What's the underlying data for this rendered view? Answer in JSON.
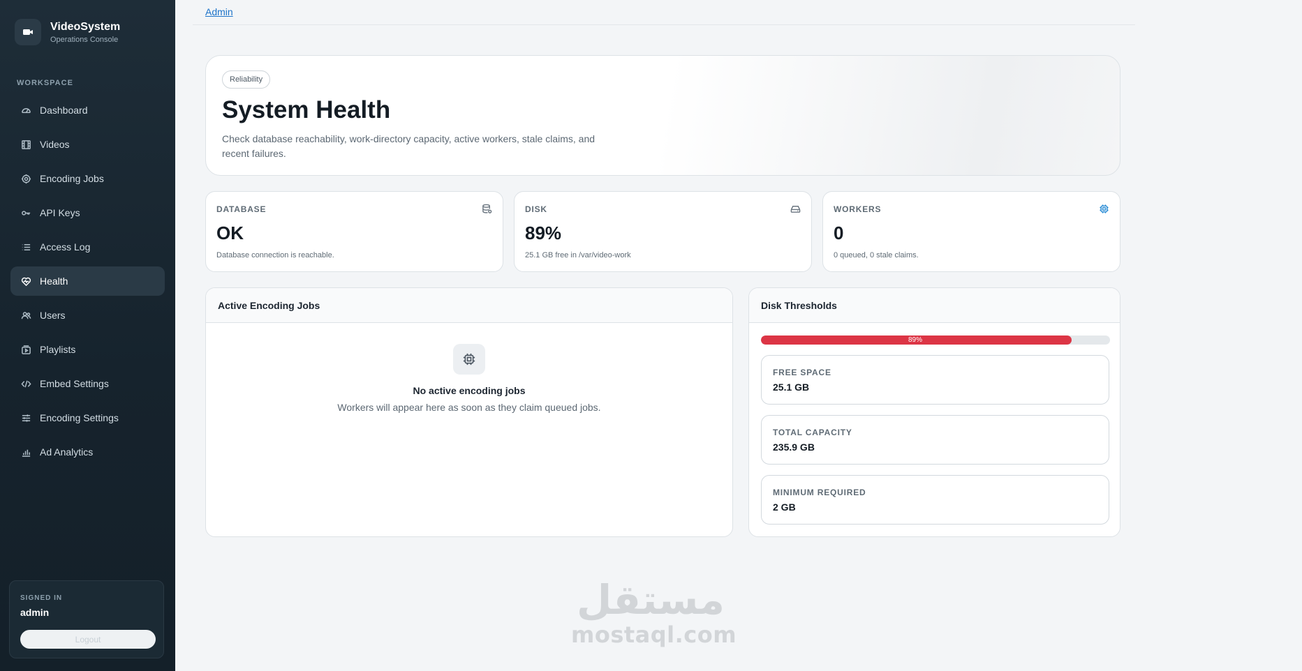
{
  "app": {
    "title": "VideoSystem",
    "subtitle": "Operations Console"
  },
  "sidebar": {
    "section_label": "WORKSPACE",
    "items": [
      {
        "label": "Dashboard",
        "icon": "gauge-icon"
      },
      {
        "label": "Videos",
        "icon": "film-icon"
      },
      {
        "label": "Encoding Jobs",
        "icon": "gear-icon"
      },
      {
        "label": "API Keys",
        "icon": "key-icon"
      },
      {
        "label": "Access Log",
        "icon": "list-icon"
      },
      {
        "label": "Health",
        "icon": "heart-pulse-icon",
        "active": true
      },
      {
        "label": "Users",
        "icon": "users-icon"
      },
      {
        "label": "Playlists",
        "icon": "playlist-icon"
      },
      {
        "label": "Embed Settings",
        "icon": "code-icon"
      },
      {
        "label": "Encoding Settings",
        "icon": "sliders-icon"
      },
      {
        "label": "Ad Analytics",
        "icon": "bar-chart-icon"
      }
    ],
    "user": {
      "label": "SIGNED IN",
      "name": "admin",
      "logout_label": "Logout"
    }
  },
  "breadcrumb": "Admin",
  "hero": {
    "chip": "Reliability",
    "title": "System Health",
    "description": "Check database reachability, work-directory capacity, active workers, stale claims, and recent failures."
  },
  "stats": {
    "database": {
      "label": "DATABASE",
      "value": "OK",
      "sub": "Database connection is reachable.",
      "icon": "database-icon"
    },
    "disk": {
      "label": "DISK",
      "value": "89%",
      "sub": "25.1 GB free in /var/video-work",
      "icon": "hard-drive-icon"
    },
    "workers": {
      "label": "WORKERS",
      "value": "0",
      "sub": "0 queued, 0 stale claims.",
      "icon": "cpu-icon",
      "icon_color": "#2f8fd6"
    }
  },
  "jobs_panel": {
    "title": "Active Encoding Jobs",
    "empty_title": "No active encoding jobs",
    "empty_sub": "Workers will appear here as soon as they claim queued jobs."
  },
  "disk_panel": {
    "title": "Disk Thresholds",
    "usage_percent": 89,
    "usage_label": "89%",
    "bar_color": "#dc3545",
    "thresholds": [
      {
        "label": "FREE SPACE",
        "value": "25.1 GB"
      },
      {
        "label": "TOTAL CAPACITY",
        "value": "235.9 GB"
      },
      {
        "label": "MINIMUM REQUIRED",
        "value": "2 GB"
      }
    ]
  },
  "watermark": {
    "arabic": "مستقل",
    "latin": "mostaql.com"
  }
}
